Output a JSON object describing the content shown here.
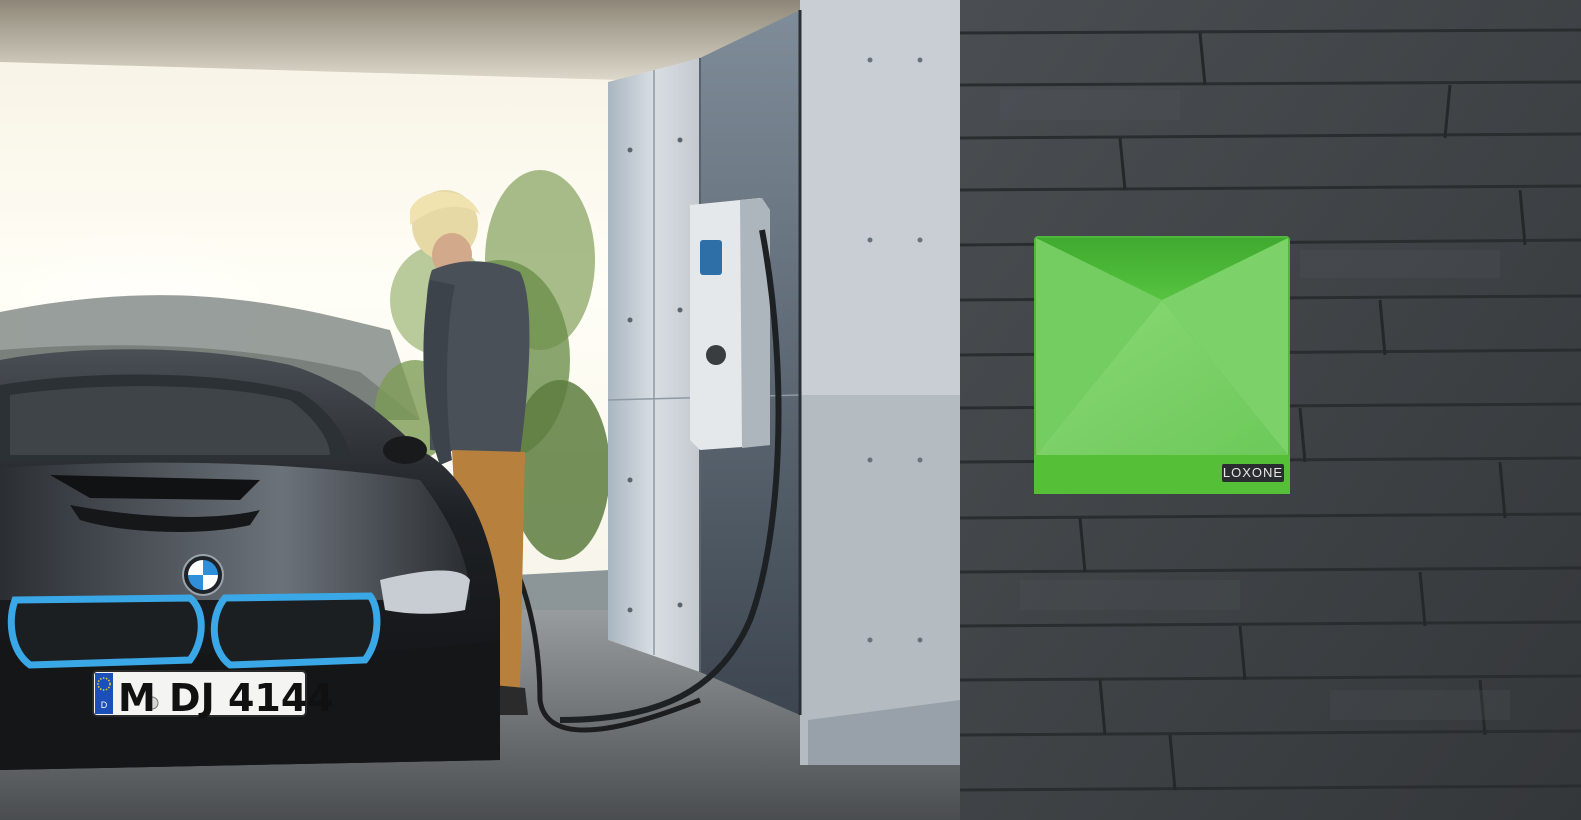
{
  "plate": {
    "country_code": "D",
    "text": "M DJ 4144"
  },
  "device": {
    "brand": "LOXONE",
    "color": "#5cc43a"
  },
  "colors": {
    "wall_dark": "#3e4246",
    "concrete": "#c7ccd1",
    "car_body": "#24272b",
    "car_accent_blue": "#3aa7e6",
    "sky": "#fdfcf2"
  },
  "icons": {
    "car_logo": "bmw-roundel-icon",
    "plate_stars": "eu-stars-icon"
  }
}
